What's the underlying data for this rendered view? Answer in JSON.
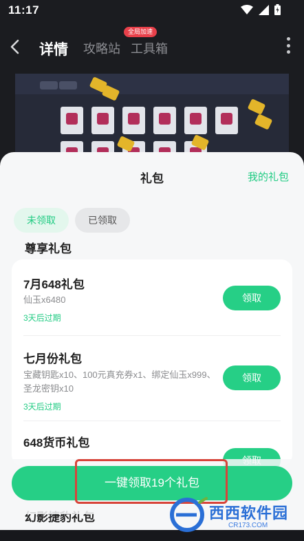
{
  "status_bar": {
    "time": "11:17"
  },
  "header": {
    "tabs": [
      {
        "label": "详情",
        "active": true
      },
      {
        "label": "攻略站",
        "active": false
      },
      {
        "label": "工具箱",
        "active": false,
        "badge": "全局加速"
      }
    ]
  },
  "sheet": {
    "title": "礼包",
    "my_gifts_link": "我的礼包",
    "filters": [
      {
        "label": "未领取",
        "active": true
      },
      {
        "label": "已领取",
        "active": false
      }
    ],
    "section_title": "尊享礼包",
    "gifts": [
      {
        "name": "7月648礼包",
        "content": "仙玉x6480",
        "expire": "3天后过期",
        "button": "领取"
      },
      {
        "name": "七月份礼包",
        "content": "宝藏钥匙x10、100元真充券x1、绑定仙玉x999、圣龙密钥x10",
        "expire": "3天后过期",
        "button": "领取"
      },
      {
        "name": "648货币礼包",
        "content": "",
        "expire": "",
        "button": "领取"
      }
    ],
    "next_section_title": "幻影捷豹礼包",
    "claim_all_button": "一键领取19个礼包"
  },
  "watermark": {
    "text": "西西软件园",
    "sub": "CR173.COM"
  },
  "colors": {
    "accent": "#26cf86",
    "accent_text": "#1fcb82",
    "highlight": "#d7443a",
    "badge": "#e8404a"
  }
}
